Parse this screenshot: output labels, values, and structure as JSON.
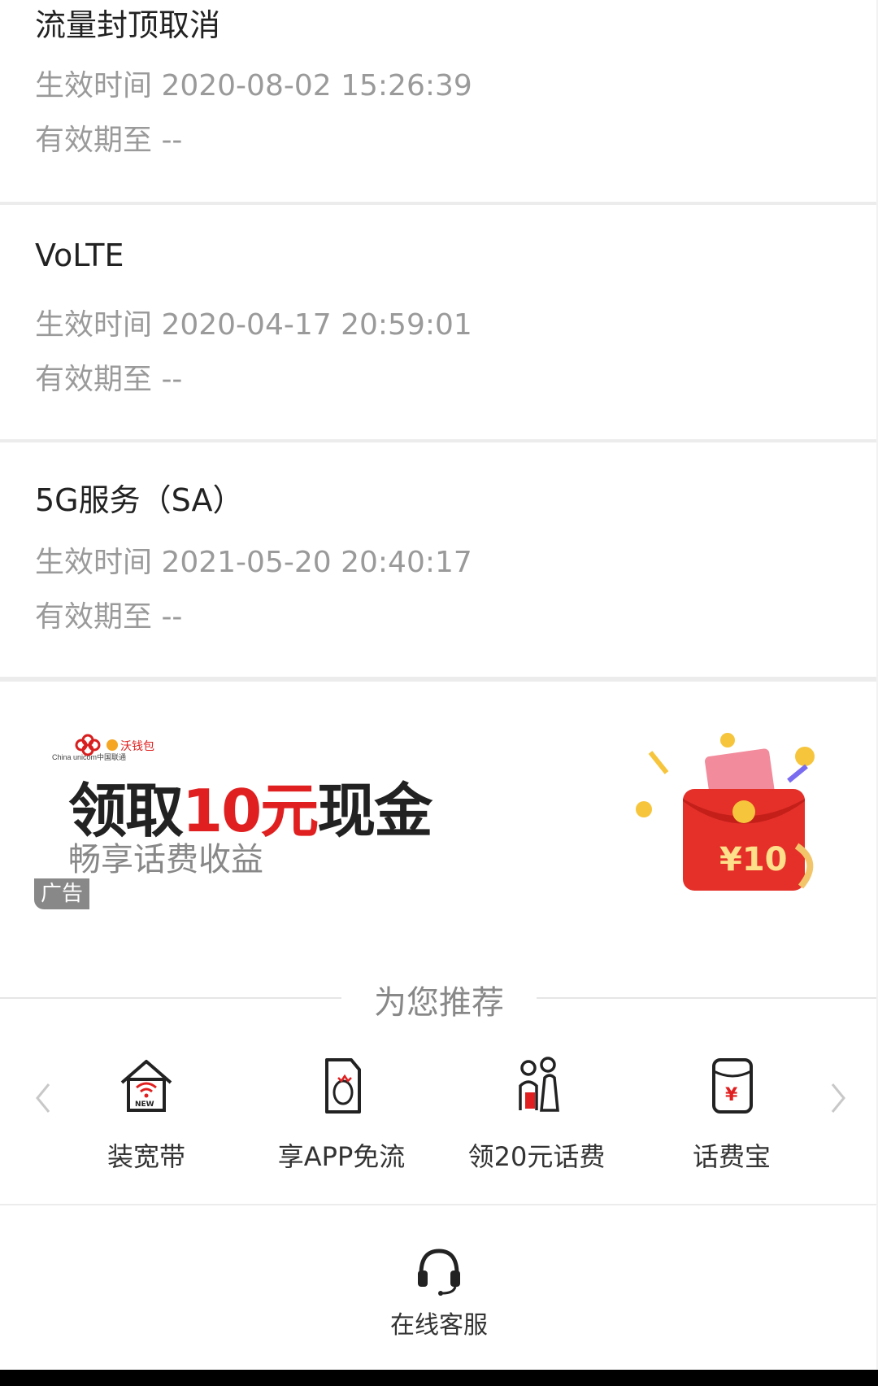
{
  "services": [
    {
      "title": "流量封顶取消",
      "effective": "生效时间 2020-08-02 15:26:39",
      "expiry": "有效期至 --"
    },
    {
      "title": "VoLTE",
      "effective": "生效时间 2020-04-17 20:59:01",
      "expiry": "有效期至 --"
    },
    {
      "title": "5G服务（SA）",
      "effective": "生效时间 2021-05-20 20:40:17",
      "expiry": "有效期至 --"
    }
  ],
  "ad": {
    "brand_left": "China unicom中国联通",
    "brand_right": "沃钱包",
    "headline_pre": "领取",
    "headline_red": "10元",
    "headline_post": "现金",
    "subtitle": "畅享话费收益",
    "badge": "广告",
    "envelope_value": "¥10"
  },
  "recommend": {
    "title": "为您推荐",
    "items": [
      {
        "label": "装宽带",
        "icon": "house-wifi-icon"
      },
      {
        "label": "享APP免流",
        "icon": "phone-app-icon"
      },
      {
        "label": "领20元话费",
        "icon": "people-gift-icon"
      },
      {
        "label": "话费宝",
        "icon": "wallet-yuan-icon"
      }
    ]
  },
  "footer": {
    "service_label": "在线客服"
  },
  "colors": {
    "accent_red": "#e02020",
    "muted_text": "#9a9a9a",
    "divider": "#ececec"
  }
}
